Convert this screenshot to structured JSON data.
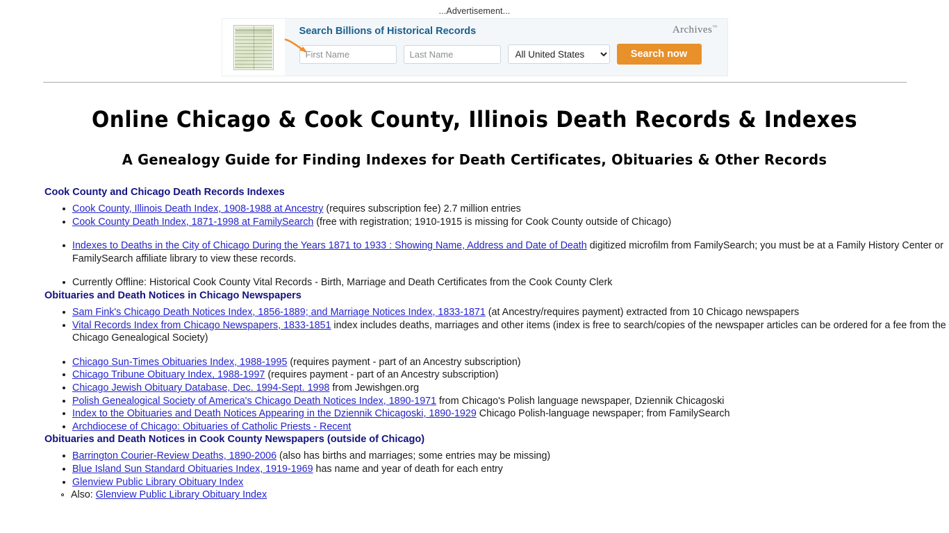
{
  "ad": {
    "label": "...Advertisement...",
    "headline": "Search Billions of Historical Records",
    "brand": "Archives",
    "brand_tm": "™",
    "first_name_placeholder": "First Name",
    "last_name_placeholder": "Last Name",
    "first_name_value": "",
    "last_name_value": "",
    "location_selected": "All United States",
    "location_options": [
      "All United States"
    ],
    "search_button": "Search now",
    "accent_color": "#e8902a",
    "headline_color": "#1b5f8c"
  },
  "page": {
    "title": "Online Chicago & Cook County, Illinois Death Records & Indexes",
    "subtitle": "A Genealogy Guide for Finding Indexes for Death Certificates, Obituaries & Other Records",
    "link_color": "#2424cc",
    "heading_color": "#131380"
  },
  "sections": [
    {
      "heading": "Cook County and Chicago Death Records Indexes",
      "items": [
        {
          "link": "Cook County, Illinois Death Index, 1908-1988 at Ancestry",
          "text": " (requires subscription fee) 2.7 million entries",
          "gap": false
        },
        {
          "link": "Cook County Death Index, 1871-1998 at FamilySearch",
          "text": " (free with registration; 1910-1915 is missing for Cook County outside of Chicago)",
          "gap": false
        },
        {
          "link": "Indexes to Deaths in the City of Chicago During the Years 1871 to 1933 : Showing Name, Address and Date of Death",
          "text": " digitized microfilm from FamilySearch; you must be at a Family History Center or FamilySearch affiliate library to view these records.",
          "gap": true
        },
        {
          "link": "",
          "text": "Currently Offline: Historical Cook County Vital Records - Birth, Marriage and Death Certificates from the Cook County Clerk",
          "gap": true
        }
      ]
    },
    {
      "heading": "Obituaries and Death Notices in Chicago Newspapers",
      "items": [
        {
          "link": "Sam Fink's Chicago Death Notices Index, 1856-1889; and Marriage Notices Index, 1833-1871",
          "text": " (at Ancestry/requires payment) extracted from 10 Chicago newspapers",
          "gap": false
        },
        {
          "link": "Vital Records Index from Chicago Newspapers, 1833-1851",
          "text": " index includes deaths, marriages and other items (index is free to search/copies of the newspaper articles can be ordered for a fee from the Chicago Genealogical Society)",
          "gap": false
        },
        {
          "link": "Chicago Sun-Times Obituaries Index, 1988-1995",
          "text": " (requires payment - part of an Ancestry subscription)",
          "gap": true
        },
        {
          "link": "Chicago Tribune Obituary Index, 1988-1997",
          "text": " (requires payment - part of an Ancestry subscription)",
          "gap": false
        },
        {
          "link": "Chicago Jewish Obituary Database, Dec. 1994-Sept. 1998",
          "text": " from Jewishgen.org",
          "gap": false
        },
        {
          "link": "Polish Genealogical Society of America's Chicago Death Notices Index, 1890-1971",
          "text": " from Chicago's Polish language newspaper, Dziennik Chicagoski",
          "gap": false
        },
        {
          "link": "Index to the Obituaries and Death Notices Appearing in the Dziennik Chicagoski, 1890-1929",
          "text": " Chicago Polish-language newspaper; from FamilySearch",
          "gap": false
        },
        {
          "link": "Archdiocese of Chicago: Obituaries of Catholic Priests - Recent",
          "text": "",
          "gap": false
        }
      ]
    },
    {
      "heading": "Obituaries and Death Notices in Cook County Newspapers (outside of Chicago)",
      "items": [
        {
          "link": "Barrington Courier-Review Deaths, 1890-2006",
          "text": " (also has births and marriages; some entries may be missing)",
          "gap": false
        },
        {
          "link": "Blue Island Sun Standard Obituaries Index, 1919-1969",
          "text": " has name and year of death for each entry",
          "gap": false
        },
        {
          "link": "Glenview Public Library Obituary Index",
          "text": "",
          "gap": false
        }
      ],
      "subitems": [
        {
          "prefix": "Also: ",
          "link": "Glenview Public Library Obituary Index",
          "text": ""
        }
      ]
    }
  ]
}
